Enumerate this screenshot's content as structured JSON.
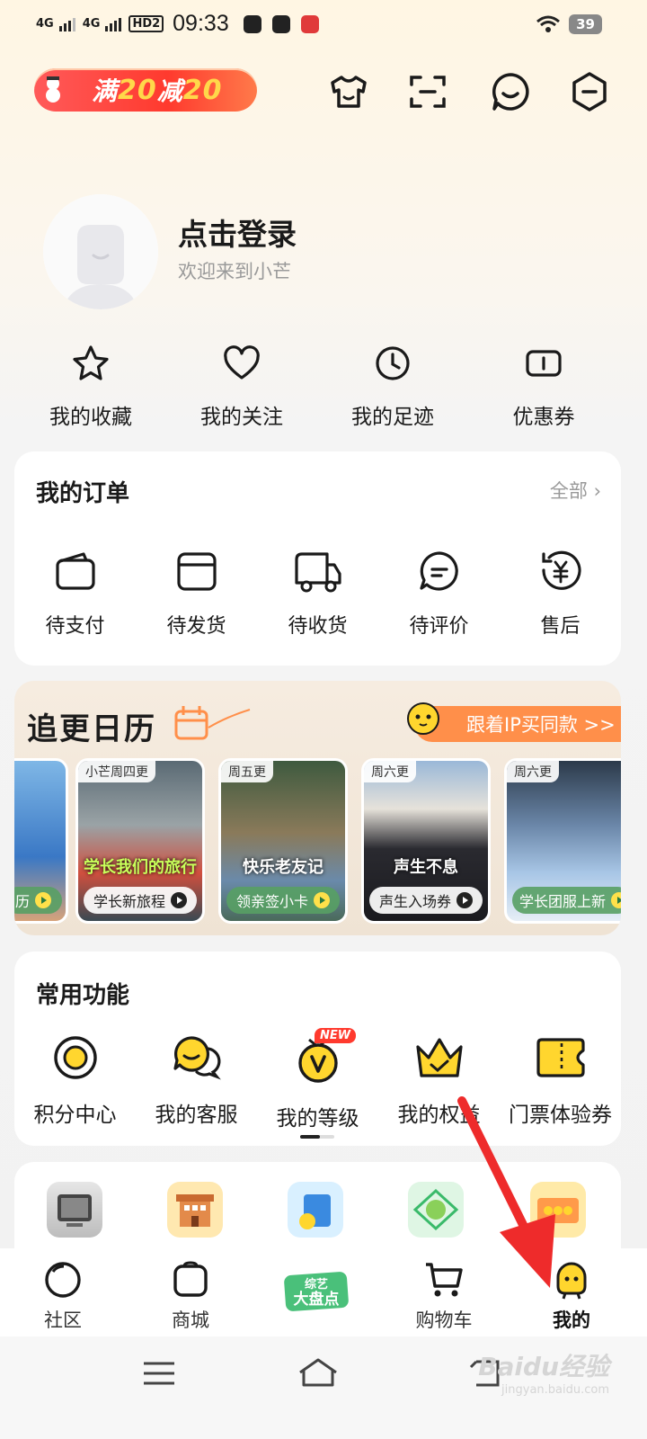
{
  "status_bar": {
    "signal1": "4G",
    "signal2": "4G",
    "hd": "HD2",
    "time": "09:33",
    "battery": "39"
  },
  "header": {
    "promo_prefix": "满",
    "promo_amount1": "20",
    "promo_mid": "减",
    "promo_amount2": "20",
    "icons": [
      "shirt-icon",
      "scan-icon",
      "message-icon",
      "settings-icon"
    ]
  },
  "profile": {
    "login_text": "点击登录",
    "welcome_text": "欢迎来到小芒"
  },
  "quick_links": [
    {
      "label": "我的收藏",
      "icon": "star-icon"
    },
    {
      "label": "我的关注",
      "icon": "heart-icon"
    },
    {
      "label": "我的足迹",
      "icon": "clock-icon"
    },
    {
      "label": "优惠券",
      "icon": "coupon-icon"
    }
  ],
  "orders": {
    "title": "我的订单",
    "all_label": "全部",
    "items": [
      {
        "label": "待支付",
        "icon": "wallet-icon"
      },
      {
        "label": "待发货",
        "icon": "box-icon"
      },
      {
        "label": "待收货",
        "icon": "truck-icon"
      },
      {
        "label": "待评价",
        "icon": "comment-icon"
      },
      {
        "label": "售后",
        "icon": "refund-icon"
      }
    ]
  },
  "calendar": {
    "title": "追更日历",
    "ip_link": "跟着IP买同款 >>",
    "posters": [
      {
        "tag": "",
        "pill": "历",
        "logo": ""
      },
      {
        "tag": "小芒周四更",
        "pill": "学长新旅程",
        "logo": "学长我们的旅行"
      },
      {
        "tag": "周五更",
        "pill": "领亲签小卡",
        "logo": "快乐老友记"
      },
      {
        "tag": "周六更",
        "pill": "声生入场券",
        "logo": "声生不息"
      },
      {
        "tag": "周六更",
        "pill": "学长团服上新",
        "logo": ""
      }
    ]
  },
  "functions": {
    "title": "常用功能",
    "new_badge": "NEW",
    "items": [
      {
        "label": "积分中心",
        "icon": "points-icon"
      },
      {
        "label": "我的客服",
        "icon": "customer-service-icon"
      },
      {
        "label": "我的等级",
        "icon": "level-icon"
      },
      {
        "label": "我的权益",
        "icon": "crown-icon"
      },
      {
        "label": "门票体验券",
        "icon": "ticket-icon"
      }
    ]
  },
  "tabs": [
    {
      "label": "社区",
      "icon": "community-icon"
    },
    {
      "label": "商城",
      "icon": "mall-icon"
    },
    {
      "label": "综艺大盘点",
      "icon": "variety-icon"
    },
    {
      "label": "购物车",
      "icon": "cart-icon"
    },
    {
      "label": "我的",
      "icon": "profile-icon"
    }
  ],
  "watermark": {
    "text": "Baidu经验",
    "sub": "jingyan.baidu.com"
  },
  "colors": {
    "accent": "#ffd62e",
    "promo": "#ff3a2e",
    "orange": "#ff8f4a"
  }
}
